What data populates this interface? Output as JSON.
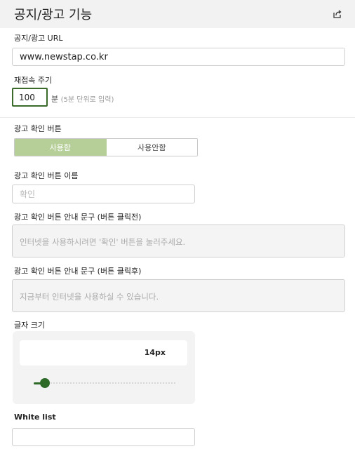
{
  "header": {
    "title": "공지/광고 기능",
    "export_icon": "export-icon"
  },
  "url_section": {
    "label": "공지/광고 URL",
    "value": "www.newstap.co.kr"
  },
  "reconnect": {
    "label": "재접속 주기",
    "value": "100",
    "unit": "분",
    "hint": "(5분 단위로 입력)"
  },
  "ad_button": {
    "label": "광고 확인 버튼",
    "options": [
      "사용함",
      "사용안함"
    ],
    "selected": "사용함"
  },
  "ad_button_name": {
    "label": "광고 확인 버튼 이름",
    "placeholder": "확인"
  },
  "guide_before": {
    "label": "광고 확인 버튼 안내 문구 (버튼 클릭전)",
    "placeholder": "인터넷을 사용하시려면 '확인' 버튼을 눌러주세요."
  },
  "guide_after": {
    "label": "광고 확인 버튼 안내 문구 (버튼 클릭후)",
    "placeholder": "지금부터 인터넷을 사용하실 수 있습니다."
  },
  "font_size": {
    "label": "글자 크기",
    "value_text": "14px",
    "slider_fraction": 0.08
  },
  "whitelist": {
    "label": "White list",
    "value": ""
  },
  "colors": {
    "accent": "#2e6b28",
    "toggle_on": "#b6cf99",
    "header_bg": "#f2f2f2"
  }
}
